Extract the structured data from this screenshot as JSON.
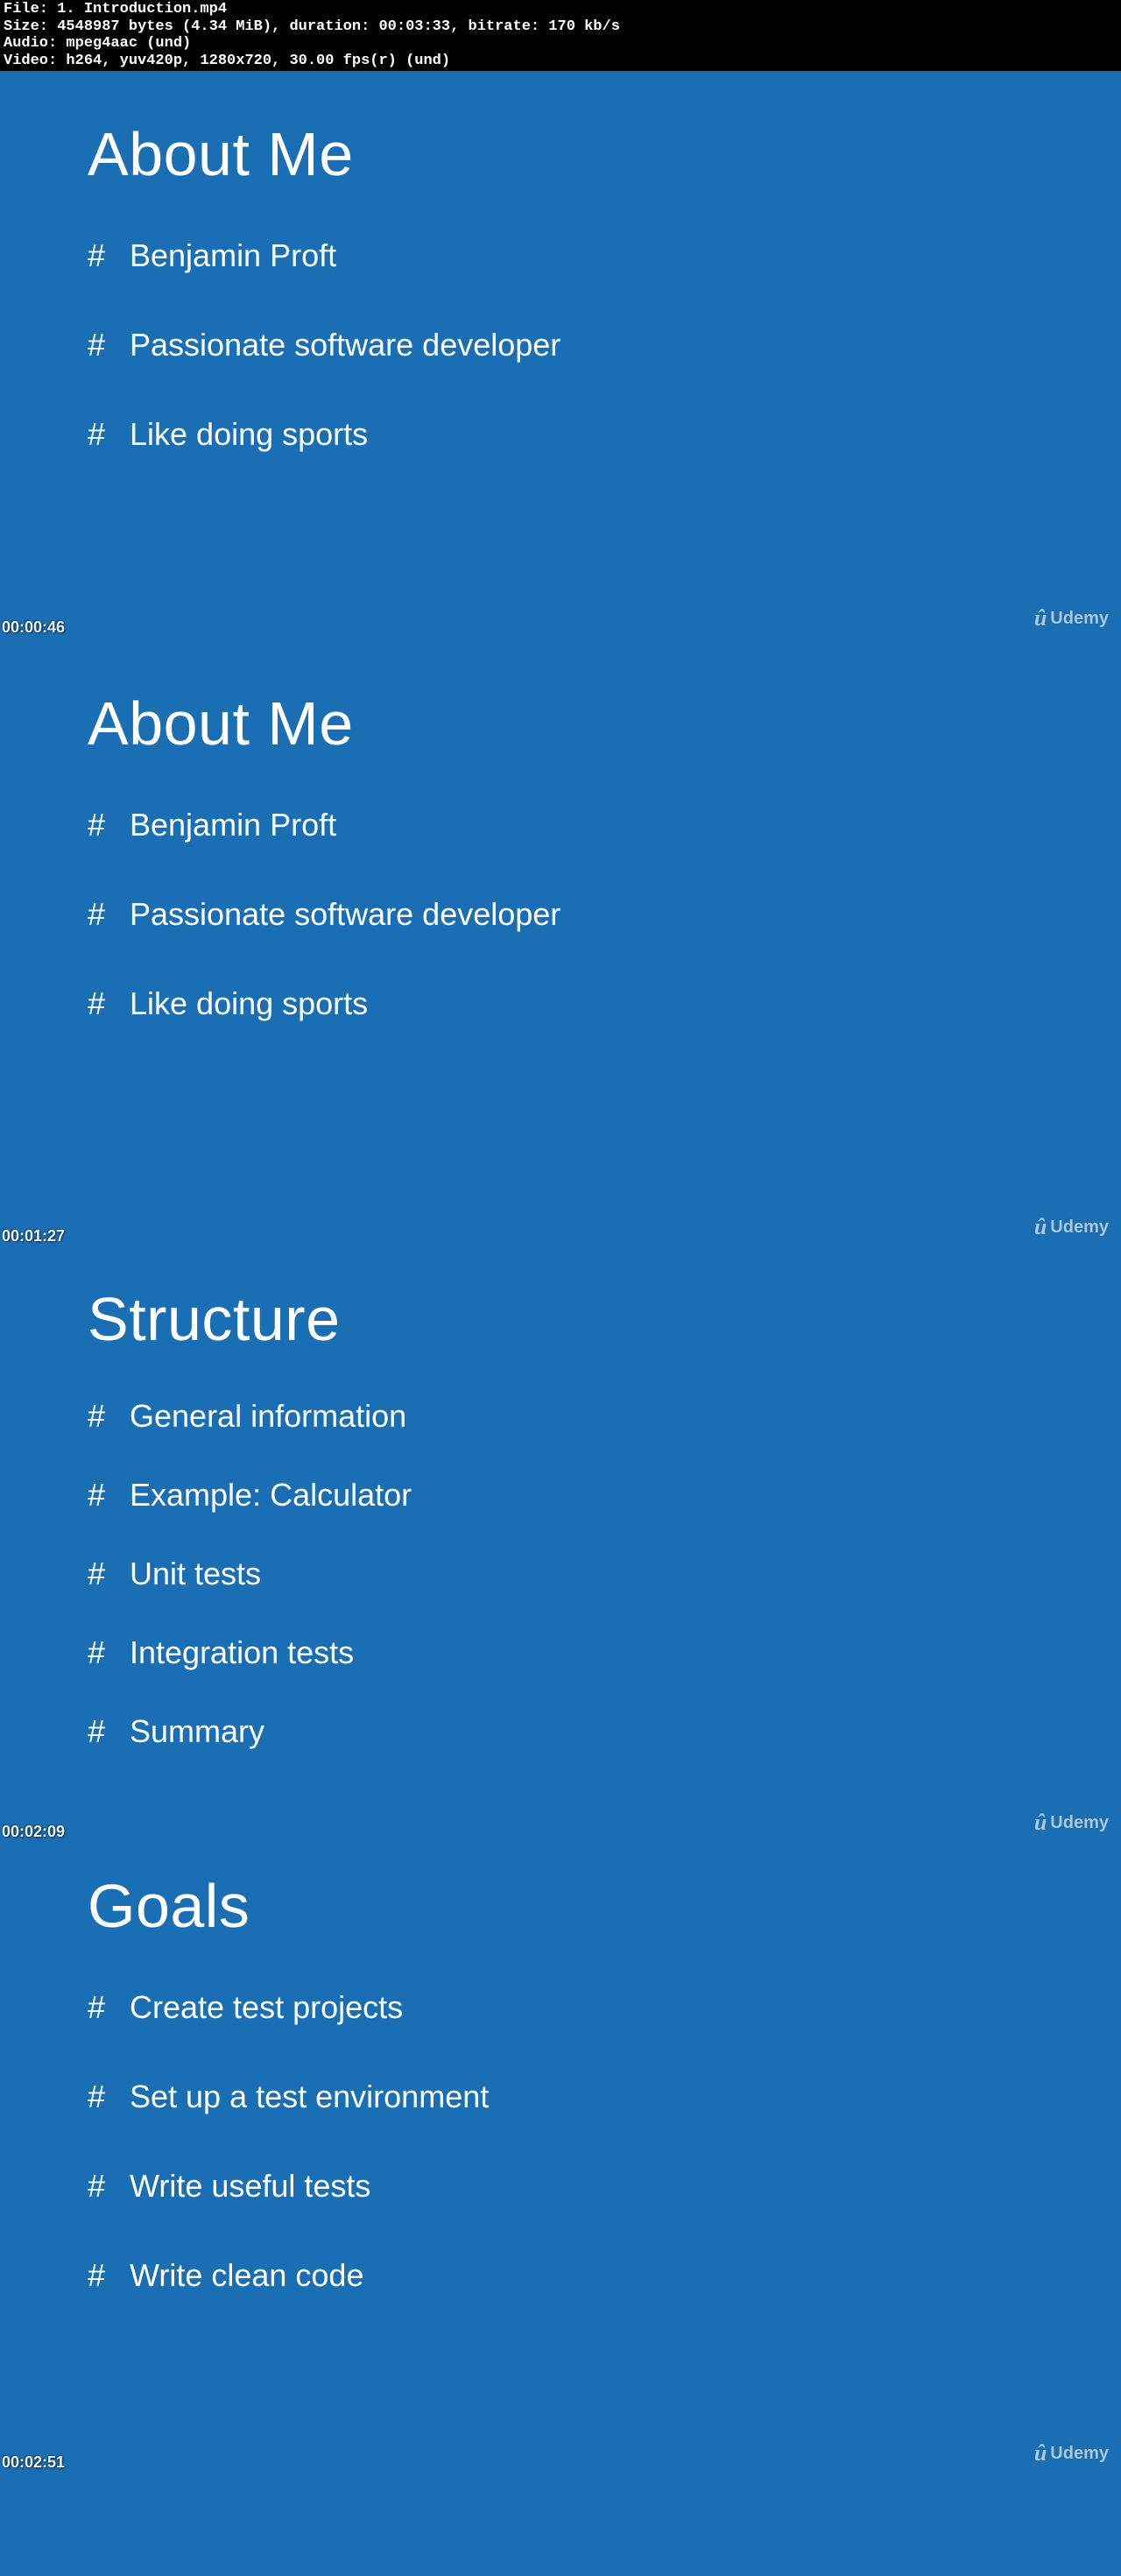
{
  "header": {
    "line1": "File: 1. Introduction.mp4",
    "line2": "Size: 4548987 bytes (4.34 MiB), duration: 00:03:33, bitrate: 170 kb/s",
    "line3": "Audio: mpeg4aac (und)",
    "line4": "Video: h264, yuv420p, 1280x720, 30.00 fps(r) (und)"
  },
  "brand": "Udemy",
  "slides": [
    {
      "title": "About Me",
      "timestamp": "00:00:46",
      "items": [
        "Benjamin Proft",
        "Passionate software developer",
        "Like doing sports"
      ]
    },
    {
      "title": "About Me",
      "timestamp": "00:01:27",
      "items": [
        "Benjamin Proft",
        "Passionate software developer",
        "Like doing sports"
      ]
    },
    {
      "title": "Structure",
      "timestamp": "00:02:09",
      "items": [
        "General information",
        "Example: Calculator",
        "Unit tests",
        "Integration tests",
        "Summary"
      ]
    },
    {
      "title": "Goals",
      "timestamp": "00:02:51",
      "items": [
        "Create test projects",
        "Set up a test environment",
        "Write useful tests",
        "Write clean code"
      ]
    }
  ]
}
